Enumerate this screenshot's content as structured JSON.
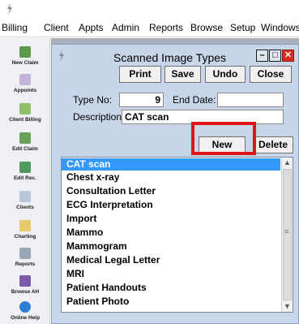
{
  "menubar": {
    "items": [
      "Billing",
      "Client",
      "Appts",
      "Admin",
      "Reports",
      "Browse",
      "Setup",
      "Windows"
    ]
  },
  "toolbar": {
    "items": [
      {
        "label": "New Claim",
        "icon": "new-claim-icon"
      },
      {
        "label": "Appoints",
        "icon": "appointments-icon"
      },
      {
        "label": "Client Billing",
        "icon": "client-billing-icon"
      },
      {
        "label": "Edit Claim",
        "icon": "edit-claim-icon"
      },
      {
        "label": "Edit Rec.",
        "icon": "edit-record-icon"
      },
      {
        "label": "Clients",
        "icon": "clients-icon"
      },
      {
        "label": "Charting",
        "icon": "charting-icon"
      },
      {
        "label": "Reports",
        "icon": "reports-icon"
      },
      {
        "label": "Browse AH",
        "icon": "browse-icon"
      },
      {
        "label": "Online Help",
        "icon": "help-icon"
      }
    ]
  },
  "window": {
    "title": "Scanned Image Types",
    "buttons": {
      "print": "Print",
      "save": "Save",
      "undo": "Undo",
      "close": "Close",
      "new": "New",
      "delete": "Delete"
    },
    "type_no_label": "Type No:",
    "type_no_value": "9",
    "end_date_label": "End Date:",
    "end_date_value": "",
    "description_label": "Description:",
    "description_value": "CAT scan",
    "controls": {
      "minimize": "–",
      "maximize": "□",
      "close": "✕"
    }
  },
  "list": {
    "items": [
      "CAT scan",
      "Chest x-ray",
      "Consultation Letter",
      "ECG Interpretation",
      "Import",
      "Mammo",
      "Mammogram",
      "Medical Legal Letter",
      "MRI",
      "Patient Handouts",
      "Patient Photo"
    ],
    "selected_index": 0
  },
  "colors": {
    "window_bg": "#c8d6ea",
    "selection": "#3399ff",
    "highlight": "#e0151a",
    "toolbar_bg": "#eef0f3"
  }
}
